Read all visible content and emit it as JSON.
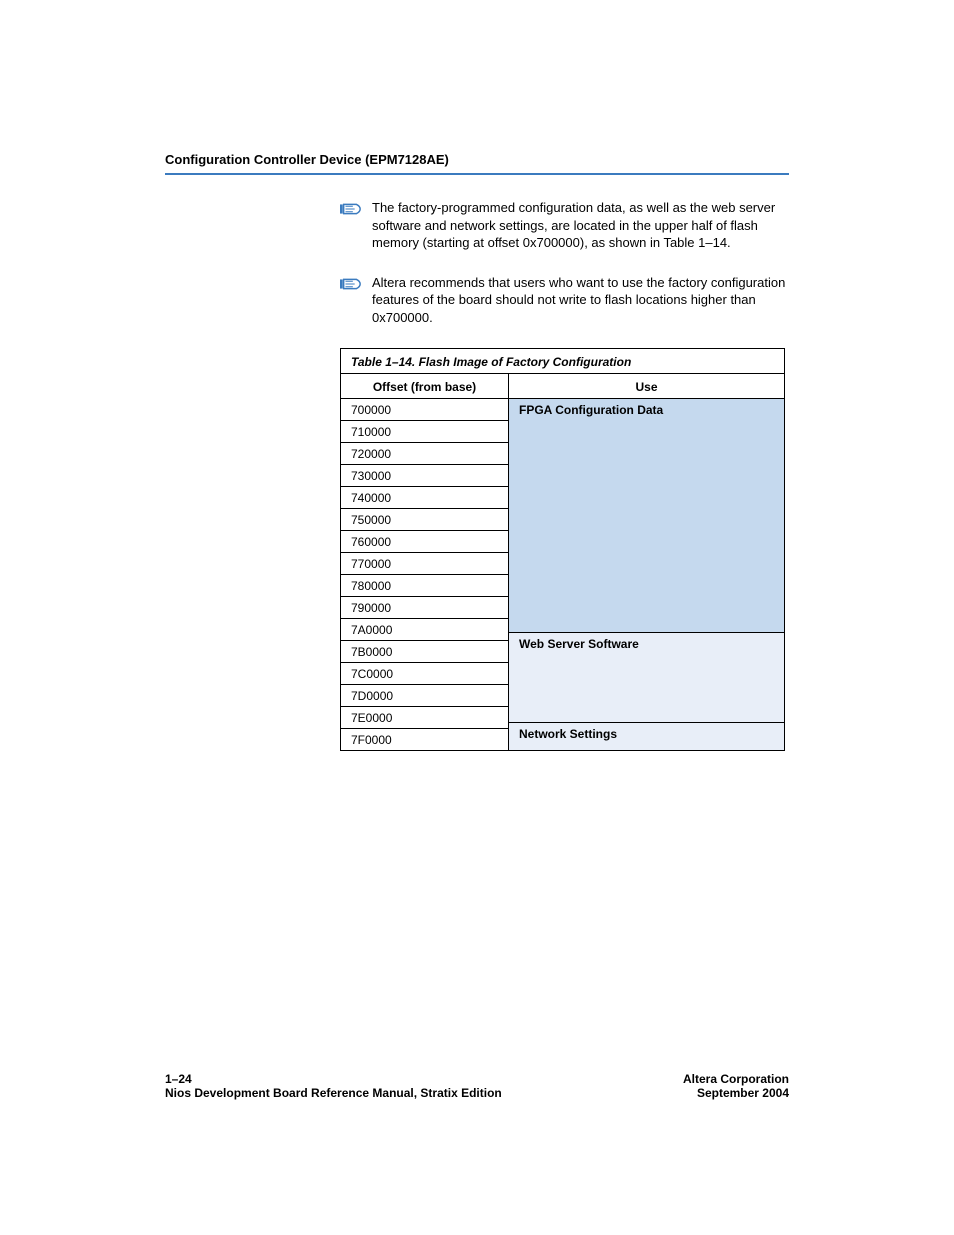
{
  "header": {
    "title": "Configuration Controller Device (EPM7128AE)"
  },
  "note1": {
    "text": "The factory-programmed configuration data, as well as the web server software and network settings, are located in the upper half of flash memory (starting at offset 0x700000), as shown in Table 1–14."
  },
  "note2": {
    "text": "Altera recommends that users who want to use the factory configuration features of the board should not write to flash locations higher than 0x700000."
  },
  "table": {
    "title": "Table 1–14. Flash Image of Factory Configuration",
    "col_offset": "Offset (from base)",
    "col_use": "Use",
    "rows": [
      {
        "offset": "700000",
        "use": "FPGA Configuration Data",
        "span": 11,
        "bg": "a"
      },
      {
        "offset": "710000"
      },
      {
        "offset": "720000"
      },
      {
        "offset": "730000"
      },
      {
        "offset": "740000"
      },
      {
        "offset": "750000"
      },
      {
        "offset": "760000"
      },
      {
        "offset": "770000"
      },
      {
        "offset": "780000"
      },
      {
        "offset": "790000"
      },
      {
        "offset": "7A0000"
      },
      {
        "offset": "7B0000",
        "use": "Web Server Software",
        "span": 4,
        "bg": "b"
      },
      {
        "offset": "7C0000"
      },
      {
        "offset": "7D0000"
      },
      {
        "offset": "7E0000"
      },
      {
        "offset": "7F0000",
        "use": "Network Settings",
        "span": 1,
        "bg": "b"
      }
    ]
  },
  "footer": {
    "page_num": "1–24",
    "doc_title": "Nios Development Board Reference Manual, Stratix Edition",
    "company": "Altera Corporation",
    "date": "September 2004"
  }
}
